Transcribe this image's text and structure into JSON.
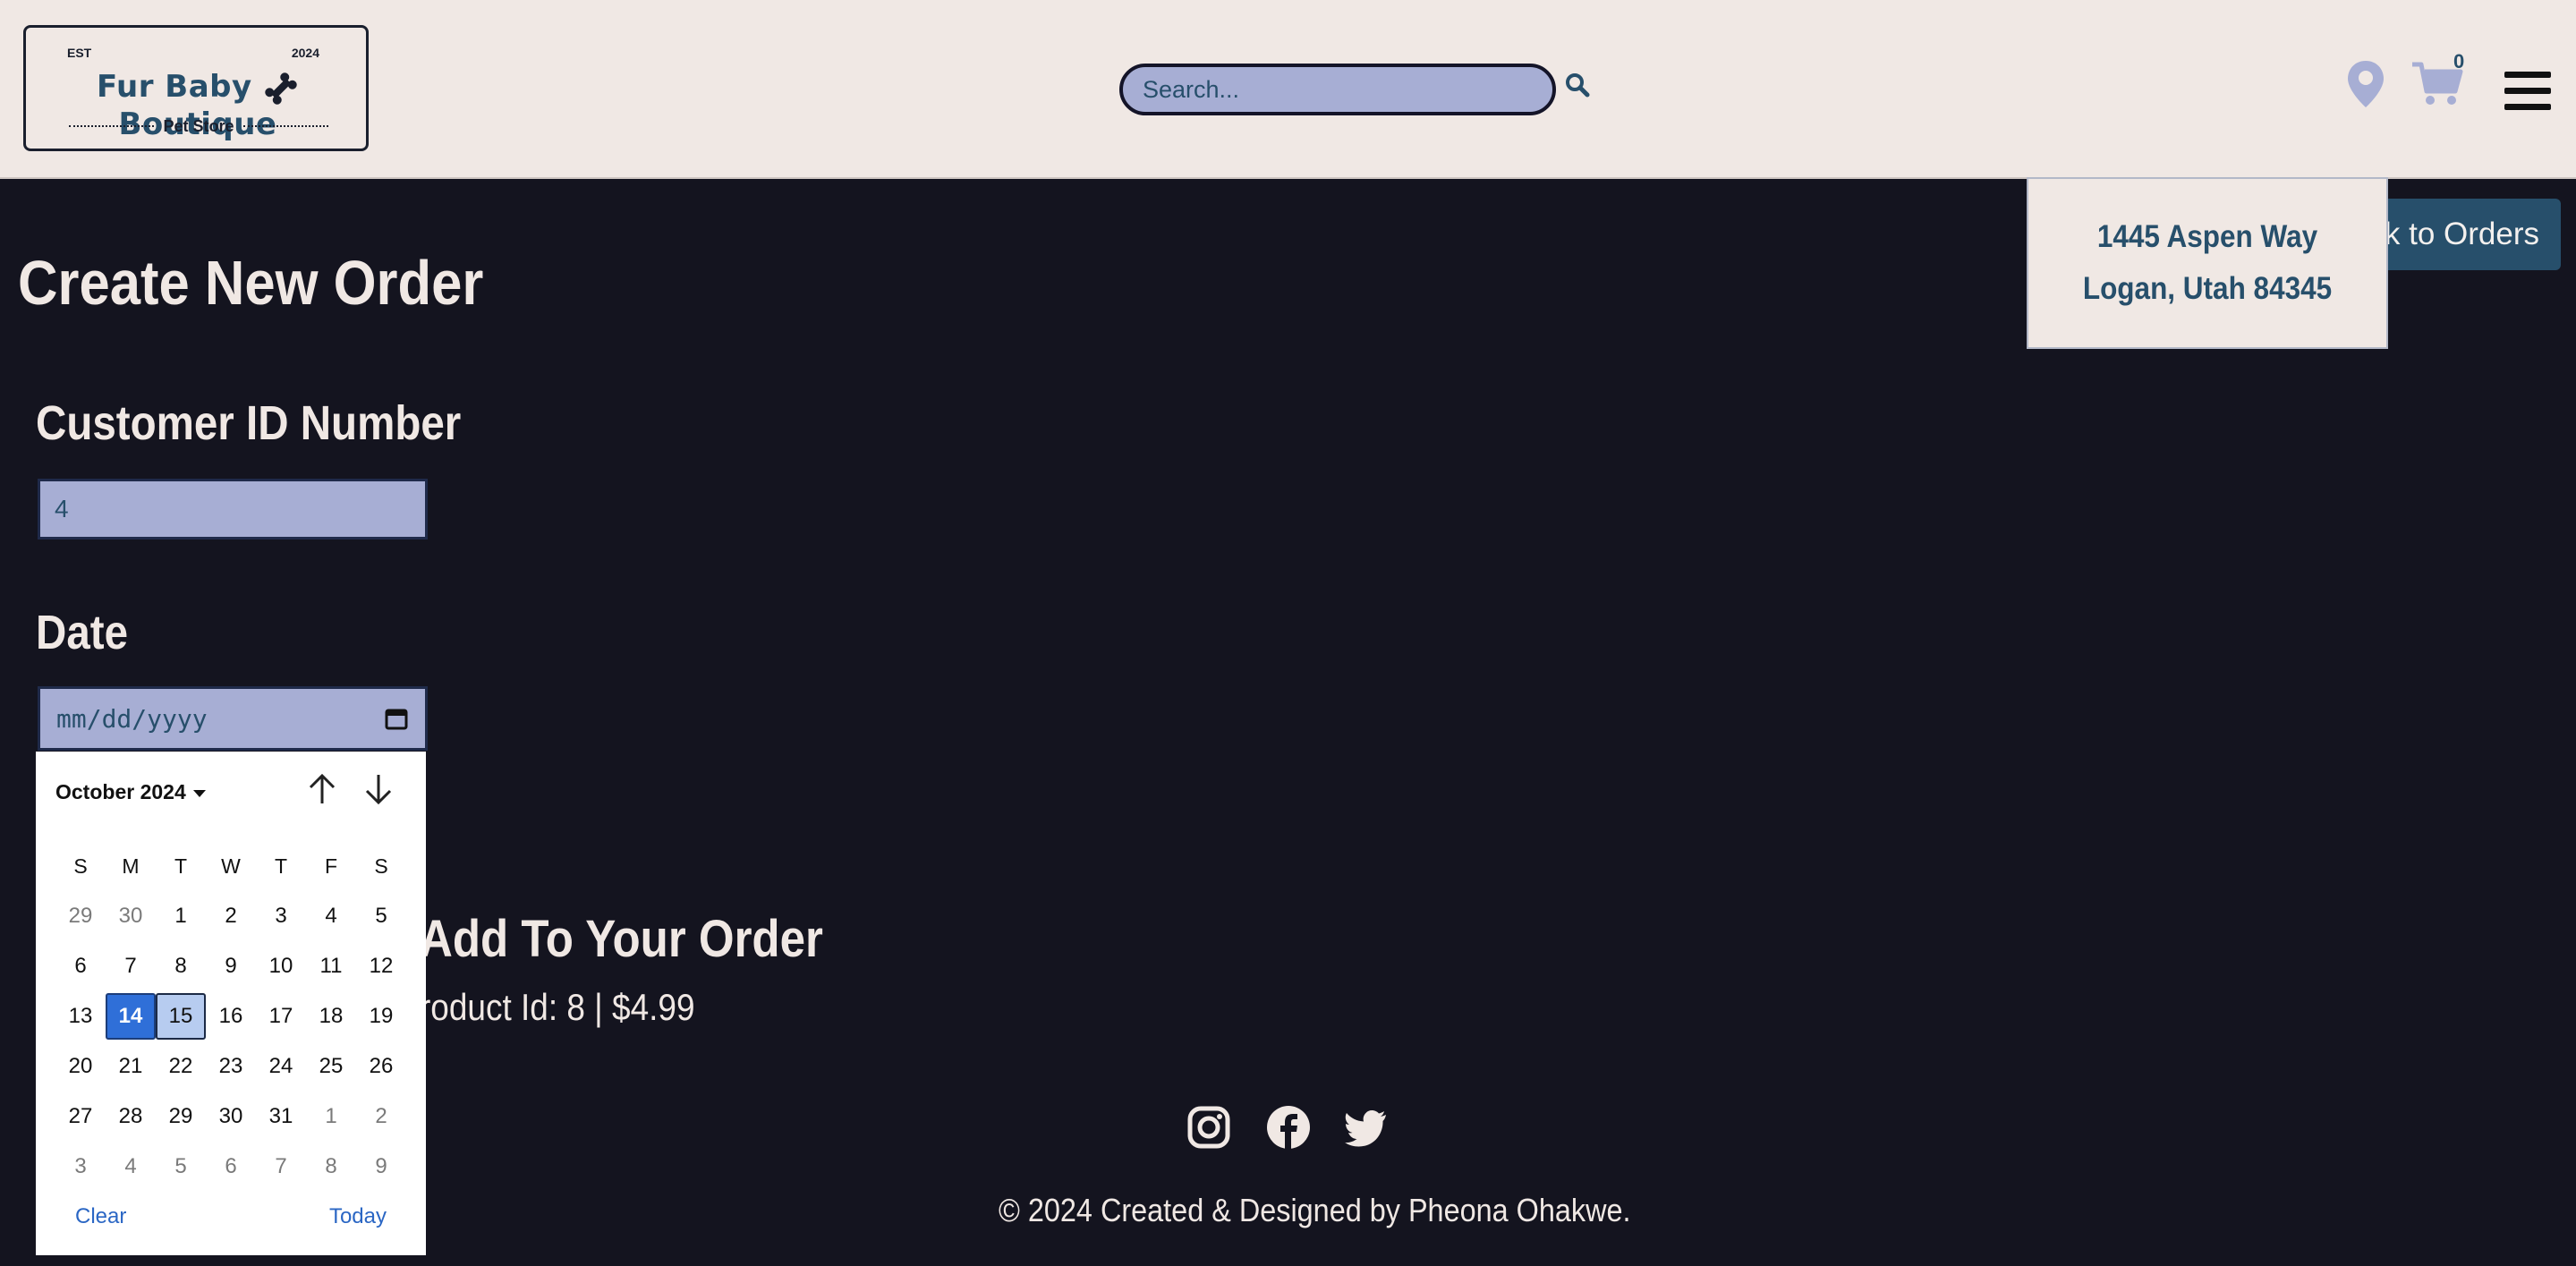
{
  "colors": {
    "header_bg": "#f0e8e4",
    "page_bg": "#14141f",
    "accent": "#274f6b",
    "input_bg": "#a7aed4",
    "selected_day": "#2f6fd8"
  },
  "header": {
    "logo": {
      "est": "EST",
      "year": "2024",
      "brand_left": "Fur Baby",
      "brand_right": "Boutique",
      "subtitle": "Pet Store"
    },
    "search": {
      "placeholder": "Search...",
      "icon": "search-icon"
    },
    "location_icon": "map-pin-icon",
    "cart": {
      "icon": "shopping-cart-icon",
      "count": "0"
    },
    "menu_icon": "hamburger-menu-icon"
  },
  "address_popover": {
    "text": "1445 Aspen Way Logan, Utah 84345"
  },
  "back_button": {
    "label": "ck to Orders"
  },
  "main": {
    "title": "Create New Order",
    "customer_label": "Customer ID Number",
    "customer_value": "4",
    "date_label": "Date",
    "date_placeholder": "mm/dd/yyyy",
    "add_heading": "Add To Your Order",
    "product_line": "roduct Id: 8 | $4.99"
  },
  "calendar": {
    "month": "October 2024",
    "weekdays": [
      "S",
      "M",
      "T",
      "W",
      "T",
      "F",
      "S"
    ],
    "weeks": [
      [
        "29",
        "30",
        "1",
        "2",
        "3",
        "4",
        "5"
      ],
      [
        "6",
        "7",
        "8",
        "9",
        "10",
        "11",
        "12"
      ],
      [
        "13",
        "14",
        "15",
        "16",
        "17",
        "18",
        "19"
      ],
      [
        "20",
        "21",
        "22",
        "23",
        "24",
        "25",
        "26"
      ],
      [
        "27",
        "28",
        "29",
        "30",
        "31",
        "1",
        "2"
      ],
      [
        "3",
        "4",
        "5",
        "6",
        "7",
        "8",
        "9"
      ]
    ],
    "selected": "14",
    "today": "15",
    "clear_label": "Clear",
    "today_label": "Today"
  },
  "footer": {
    "social": [
      "instagram-icon",
      "facebook-icon",
      "twitter-icon"
    ],
    "credit": "© 2024 Created & Designed by Pheona Ohakwe."
  }
}
